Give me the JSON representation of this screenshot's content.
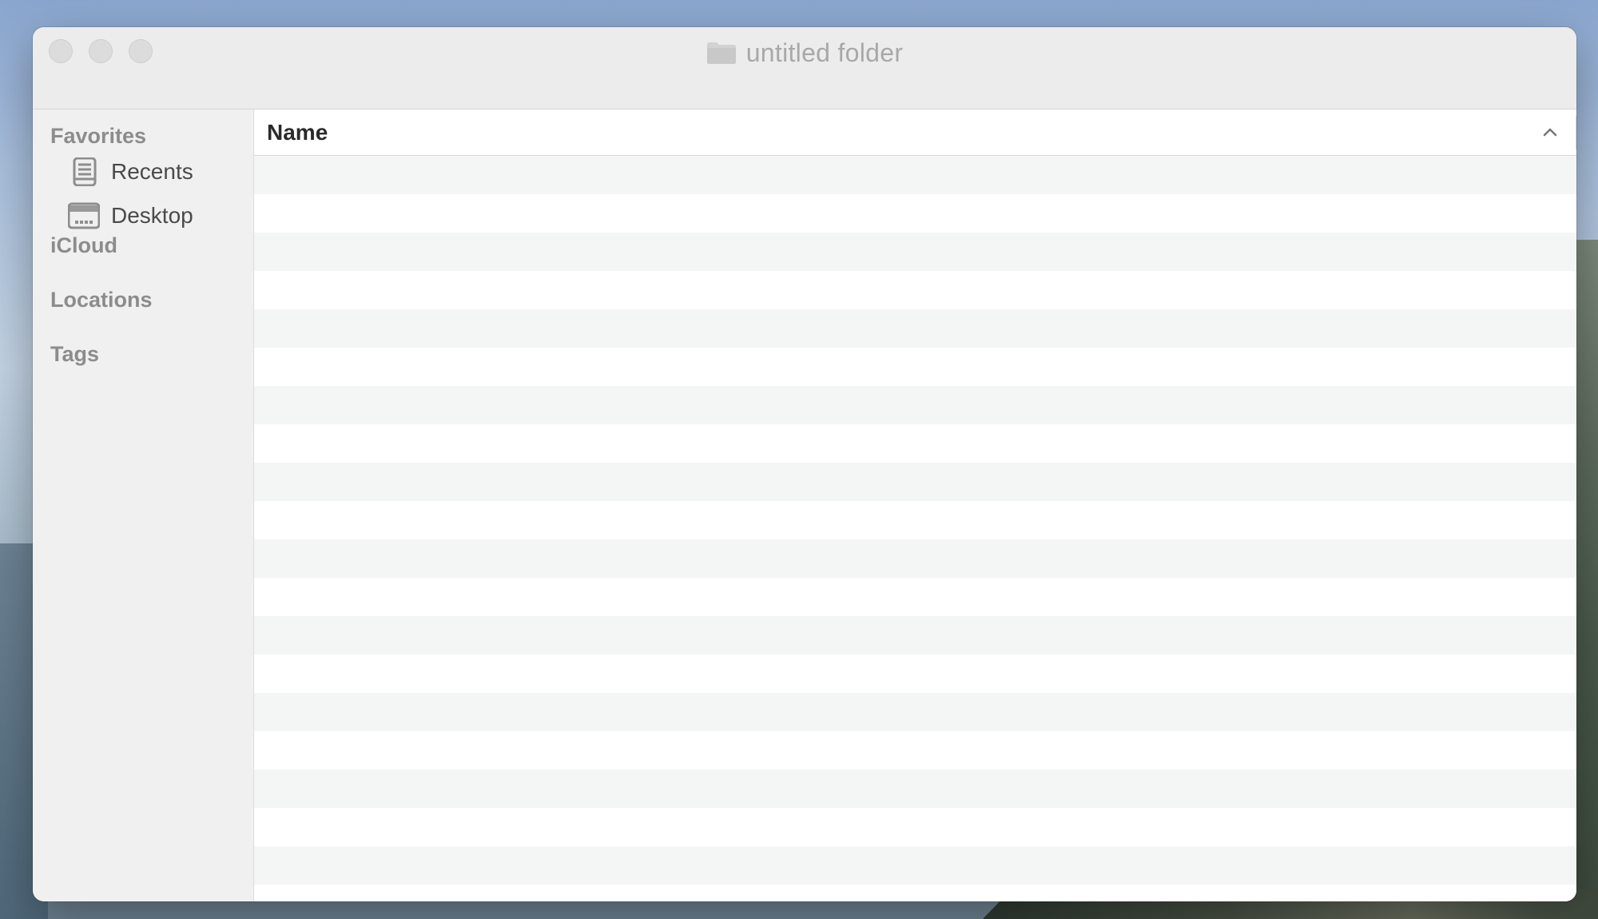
{
  "window": {
    "title": "untitled folder",
    "title_icon": "folder-icon"
  },
  "sidebar": {
    "sections": {
      "favorites": "Favorites",
      "icloud": "iCloud",
      "locations": "Locations",
      "tags": "Tags"
    },
    "favorites_items": [
      {
        "label": "Recents",
        "icon": "recents-icon"
      },
      {
        "label": "Desktop",
        "icon": "desktop-icon"
      }
    ]
  },
  "list": {
    "columns": [
      {
        "label": "Name",
        "sort": "ascending"
      }
    ],
    "rows": []
  },
  "colors": {
    "window_bg": "#ececec",
    "sidebar_bg": "#f0f0f0",
    "row_stripe": "#f4f5f5",
    "row_plain": "#ffffff",
    "traffic_light_inactive": "#dcdcdc"
  }
}
